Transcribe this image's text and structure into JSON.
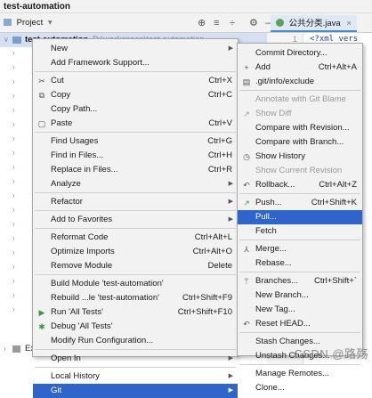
{
  "window_title": "test-automation",
  "toolbar": {
    "project_label": "Project",
    "project_arrow": "▾",
    "icons": [
      "target-icon",
      "collapse-icon",
      "expand-icon",
      "settings-icon",
      "minimize-icon"
    ]
  },
  "editor_tab": {
    "label": "公共分类.java",
    "close": "×"
  },
  "editor": {
    "line_number": "1",
    "code_snippet": "<?xml vers"
  },
  "tree": {
    "root_label": "test-automation",
    "root_hint": "D:\\workspace\\test-automation",
    "bottom_label": "Ext"
  },
  "context_menu": {
    "items": [
      {
        "label": "New",
        "submenu": true
      },
      {
        "label": "Add Framework Support..."
      },
      {
        "separator": true
      },
      {
        "label": "Cut",
        "shortcut": "Ctrl+X",
        "icon": "✂"
      },
      {
        "label": "Copy",
        "shortcut": "Ctrl+C",
        "icon": "⧉"
      },
      {
        "label": "Copy Path..."
      },
      {
        "label": "Paste",
        "shortcut": "Ctrl+V",
        "icon": "▢"
      },
      {
        "separator": true
      },
      {
        "label": "Find Usages",
        "shortcut": "Ctrl+G"
      },
      {
        "label": "Find in Files...",
        "shortcut": "Ctrl+H"
      },
      {
        "label": "Replace in Files...",
        "shortcut": "Ctrl+R"
      },
      {
        "label": "Analyze",
        "submenu": true
      },
      {
        "separator": true
      },
      {
        "label": "Refactor",
        "submenu": true
      },
      {
        "separator": true
      },
      {
        "label": "Add to Favorites",
        "submenu": true
      },
      {
        "separator": true
      },
      {
        "label": "Reformat Code",
        "shortcut": "Ctrl+Alt+L"
      },
      {
        "label": "Optimize Imports",
        "shortcut": "Ctrl+Alt+O"
      },
      {
        "label": "Remove Module",
        "shortcut": "Delete"
      },
      {
        "separator": true
      },
      {
        "label": "Build Module 'test-automation'"
      },
      {
        "label": "Rebuild ...le 'test-automation'",
        "shortcut": "Ctrl+Shift+F9"
      },
      {
        "label": "Run 'All Tests'",
        "shortcut": "Ctrl+Shift+F10",
        "icon": "▶",
        "icon_color": "#3c9a3c"
      },
      {
        "label": "Debug 'All Tests'",
        "icon": "✱",
        "icon_color": "#3c9a3c"
      },
      {
        "label": "Modify Run Configuration..."
      },
      {
        "separator": true
      },
      {
        "label": "Open In",
        "submenu": true
      },
      {
        "separator": true
      },
      {
        "label": "Local History",
        "submenu": true
      },
      {
        "label": "Git",
        "submenu": true,
        "selected": true
      }
    ]
  },
  "git_submenu": {
    "items": [
      {
        "label": "Commit Directory..."
      },
      {
        "label": "Add",
        "shortcut": "Ctrl+Alt+A",
        "icon": "+"
      },
      {
        "label": ".git/info/exclude",
        "icon": "▤"
      },
      {
        "separator": true
      },
      {
        "label": "Annotate with Git Blame",
        "disabled": true
      },
      {
        "label": "Show Diff",
        "disabled": true,
        "icon": "↗"
      },
      {
        "label": "Compare with Revision..."
      },
      {
        "label": "Compare with Branch..."
      },
      {
        "label": "Show History",
        "icon": "◷"
      },
      {
        "label": "Show Current Revision",
        "disabled": true
      },
      {
        "label": "Rollback...",
        "shortcut": "Ctrl+Alt+Z",
        "icon": "↶"
      },
      {
        "separator": true
      },
      {
        "label": "Push...",
        "shortcut": "Ctrl+Shift+K",
        "icon": "↗",
        "icon_color": "#3c9a3c"
      },
      {
        "label": "Pull...",
        "selected": true
      },
      {
        "label": "Fetch"
      },
      {
        "separator": true
      },
      {
        "label": "Merge...",
        "icon": "⅄"
      },
      {
        "label": "Rebase..."
      },
      {
        "separator": true
      },
      {
        "label": "Branches...",
        "shortcut": "Ctrl+Shift+`",
        "icon": "ᛘ"
      },
      {
        "label": "New Branch..."
      },
      {
        "label": "New Tag..."
      },
      {
        "label": "Reset HEAD...",
        "icon": "↶"
      },
      {
        "separator": true
      },
      {
        "label": "Stash Changes..."
      },
      {
        "label": "Unstash Changes..."
      },
      {
        "separator": true
      },
      {
        "label": "Manage Remotes..."
      },
      {
        "label": "Clone..."
      }
    ]
  },
  "watermark": "CSDN @路殇"
}
